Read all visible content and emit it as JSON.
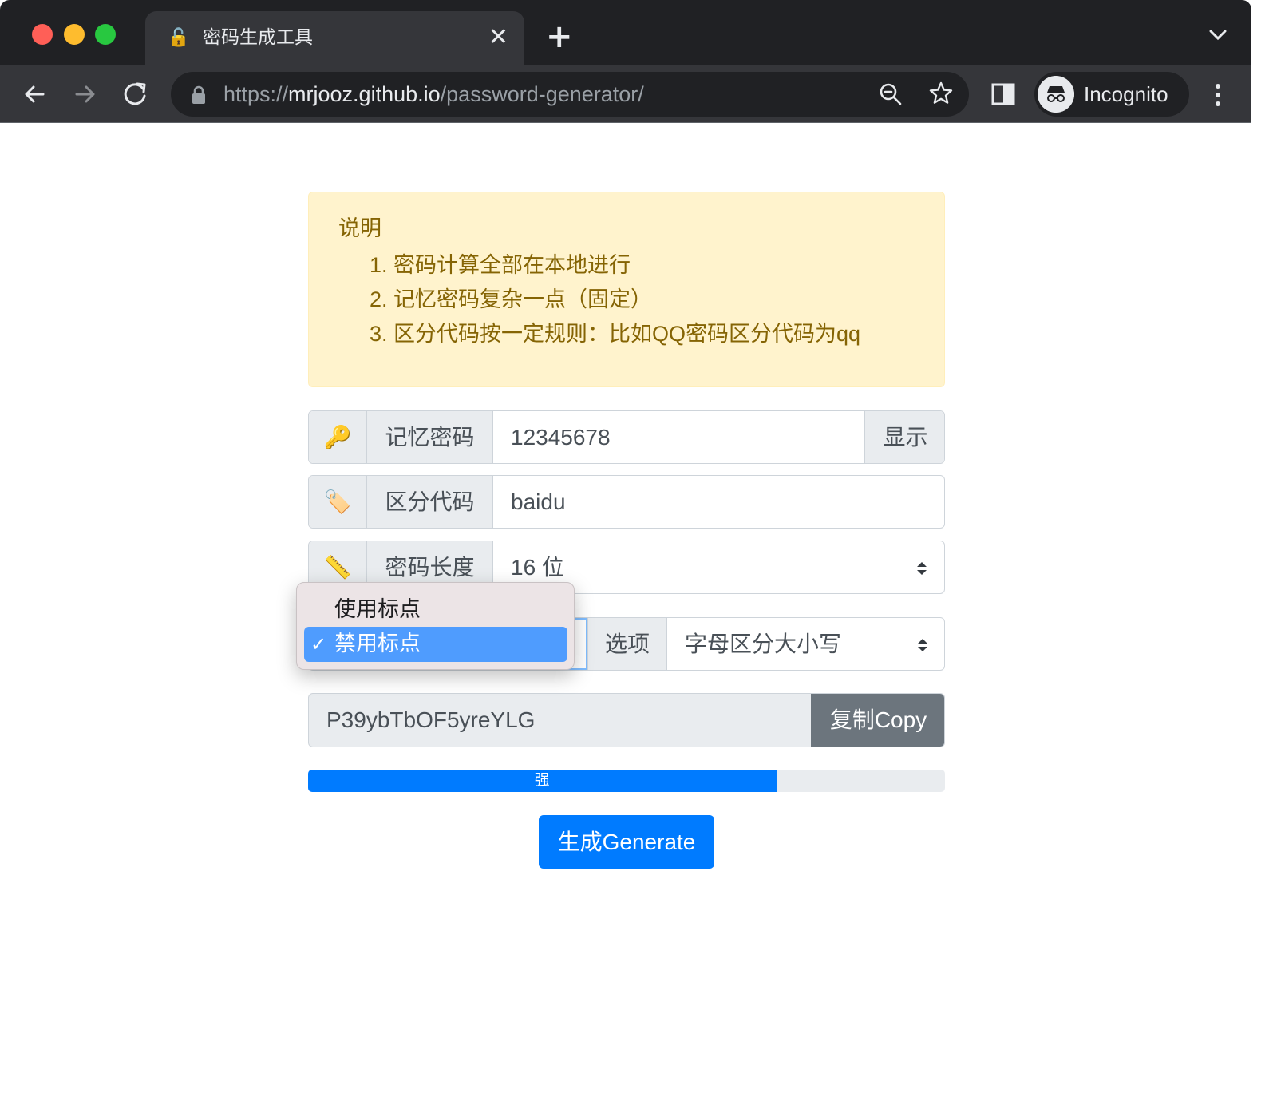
{
  "browser": {
    "tab_title": "密码生成工具",
    "tab_favicon": "🔓",
    "url_scheme": "https://",
    "url_host": "mrjooz.github.io",
    "url_path": "/password-generator/",
    "incognito_label": "Incognito"
  },
  "notice": {
    "title": "说明",
    "items": [
      "1. 密码计算全部在本地进行",
      "2. 记忆密码复杂一点（固定）",
      "3. 区分代码按一定规则：比如QQ密码区分代码为qq"
    ]
  },
  "form": {
    "memory_password": {
      "icon": "🔑",
      "label": "记忆密码",
      "value": "12345678",
      "toggle_label": "显示"
    },
    "distinguish_code": {
      "icon": "🏷️",
      "label": "区分代码",
      "value": "baidu"
    },
    "length": {
      "icon": "📏",
      "label": "密码长度",
      "value": "16 位"
    },
    "options": {
      "label": "选项",
      "value": "字母区分大小写"
    }
  },
  "punctuation_dropdown": {
    "options": [
      "使用标点",
      "禁用标点"
    ],
    "selected_index": 1
  },
  "result": {
    "password": "P39ybTbOF5yreYLG",
    "copy_label": "复制Copy"
  },
  "strength": {
    "label": "强",
    "percent": 73.5,
    "color": "#007bff"
  },
  "generate_label": "生成Generate"
}
